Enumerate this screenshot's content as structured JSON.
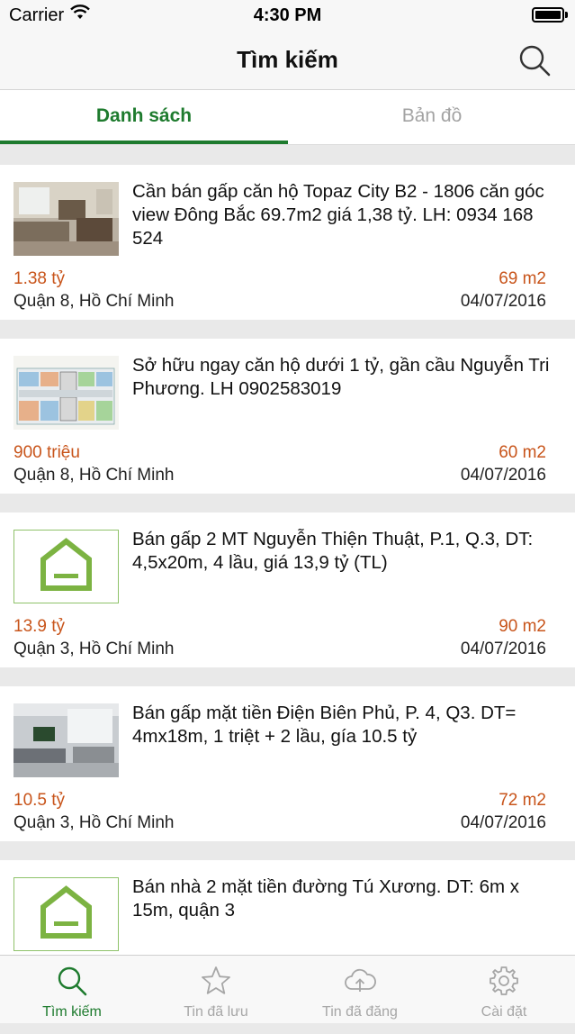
{
  "status_bar": {
    "carrier": "Carrier",
    "time": "4:30 PM"
  },
  "nav": {
    "title": "Tìm kiếm"
  },
  "tabs": {
    "list": "Danh sách",
    "map": "Bản đồ"
  },
  "listings": [
    {
      "title": "Cần bán gấp căn hộ Topaz City B2 - 1806 căn góc view Đông Bắc 69.7m2 giá 1,38 tỷ. LH: 0934 168 524",
      "price": "1.38 tỷ",
      "area": "69 m2",
      "location": "Quận 8, Hồ Chí Minh",
      "date": "04/07/2016",
      "thumb": "living-room-photo"
    },
    {
      "title": "Sở hữu ngay căn hộ dưới 1 tỷ, gần cầu Nguyễn Tri Phương. LH 0902583019",
      "price": "900 triệu",
      "area": "60 m2",
      "location": "Quận 8, Hồ Chí Minh",
      "date": "04/07/2016",
      "thumb": "floor-plan-image"
    },
    {
      "title": "Bán gấp 2 MT Nguyễn Thiện Thuật, P.1, Q.3, DT: 4,5x20m, 4 lầu, giá 13,9 tỷ (TL)",
      "price": "13.9 tỷ",
      "area": "90 m2",
      "location": "Quận 3, Hồ Chí Minh",
      "date": "04/07/2016",
      "thumb": "house-placeholder-icon"
    },
    {
      "title": "Bán gấp mặt tiền Điện Biên Phủ, P. 4, Q3. DT= 4mx18m, 1 triệt + 2 lầu, gía 10.5 tỷ",
      "price": "10.5 tỷ",
      "area": "72 m2",
      "location": "Quận 3, Hồ Chí Minh",
      "date": "04/07/2016",
      "thumb": "interior-photo"
    },
    {
      "title": "Bán nhà 2 mặt tiền đường Tú Xương. DT: 6m x 15m, quận 3",
      "thumb": "house-placeholder-icon"
    }
  ],
  "tab_bar": [
    {
      "label": "Tìm kiếm",
      "icon": "search-icon",
      "active": true
    },
    {
      "label": "Tin đã lưu",
      "icon": "star-icon",
      "active": false
    },
    {
      "label": "Tin đã đăng",
      "icon": "cloud-upload-icon",
      "active": false
    },
    {
      "label": "Cài đặt",
      "icon": "gear-icon",
      "active": false
    }
  ],
  "colors": {
    "accent": "#1e7b2e",
    "price": "#c8541a",
    "placeholder_green": "#7cb342"
  }
}
